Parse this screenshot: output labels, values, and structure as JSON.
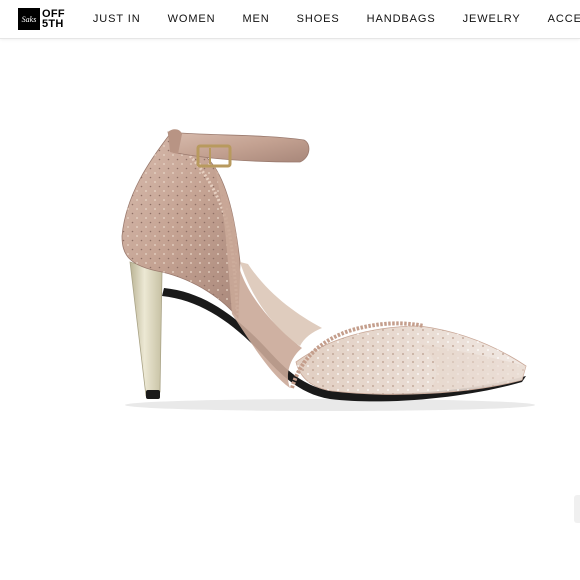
{
  "brand": {
    "mark_text": "Saks",
    "word_line1": "OFF",
    "word_line2": "5TH"
  },
  "nav": {
    "items": [
      {
        "label": "JUST IN"
      },
      {
        "label": "WOMEN"
      },
      {
        "label": "MEN"
      },
      {
        "label": "SHOES"
      },
      {
        "label": "HANDBAGS"
      },
      {
        "label": "JEWELRY"
      },
      {
        "label": "ACCESSORIES"
      }
    ]
  },
  "product": {
    "image_subject": "rose-gold rhinestone ankle-strap pointed-toe pump",
    "colors": {
      "satin": "#c9a897",
      "satin_shadow": "#a9867a",
      "heel": "#d8d2b8",
      "mesh": "#e8dcd3",
      "sole": "#1a1a1a",
      "buckle": "#b89a5e"
    }
  }
}
